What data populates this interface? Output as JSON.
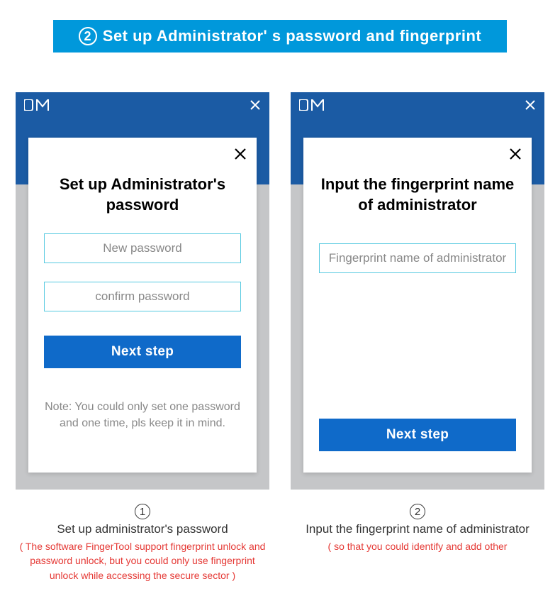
{
  "header": {
    "step_number": "2",
    "title": "Set up  Administrator'  s  password and fingerprint"
  },
  "panel1": {
    "modal_title": "Set up  Administrator's password",
    "new_password_placeholder": "New password",
    "confirm_password_placeholder": "confirm password",
    "button_label": "Next step",
    "note": "Note: You could only set one password and one time, pls keep it in mind."
  },
  "panel2": {
    "modal_title": "Input the fingerprint name of administrator",
    "fingerprint_name_placeholder": "Fingerprint name of administrator",
    "button_label": "Next step"
  },
  "caption1": {
    "number": "1",
    "title": "Set up  administrator's  password",
    "note": "( The software FingerTool support fingerprint unlock and password unlock, but you could only use fingerprint unlock while accessing the secure sector )"
  },
  "caption2": {
    "number": "2",
    "title": "Input the  fingerprint name of administrator",
    "note": "( so that you could identify and add other"
  }
}
